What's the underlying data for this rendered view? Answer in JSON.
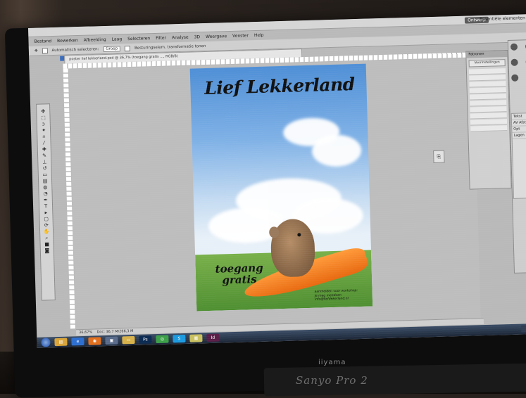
{
  "photo": {
    "monitor_brand": "iiyama",
    "keyboard_text": "Sanyo Pro 2"
  },
  "photoshop": {
    "menu": [
      "Bestand",
      "Bewerken",
      "Afbeelding",
      "Laag",
      "Selecteren",
      "Filter",
      "Analyse",
      "3D",
      "Weergave",
      "Venster",
      "Help"
    ],
    "workspace_button": "Ontwerp",
    "workspace_label": "Essentiële elementen",
    "options": {
      "auto_select_label": "Automatisch selecteren:",
      "auto_select_value": "Groep",
      "transform_label": "Besturingselem. transformatie tonen"
    },
    "document_tab": "poster lief lekkerland.psd @ 36,7% (toegang gratis ..., RGB/8)",
    "status_zoom": "36,67%",
    "status_doc": "Doc: 36,7 M/266,3 M",
    "panel": {
      "title": "Patronen",
      "preset_button": "Voorinstellingen"
    },
    "layers_panel": [
      "Tekst",
      "AV Afstand",
      "Opt",
      "Lagen"
    ],
    "colors": {
      "workspace": "#bdbdbd",
      "panel": "#d0d0d0",
      "sky": "#4f8fd6",
      "grass": "#4f8f32",
      "carrot": "#e86910"
    }
  },
  "poster": {
    "title": "Lief Lekkerland",
    "free_entry_line1": "toegang",
    "free_entry_line2": "gratis",
    "info_lines": [
      "aanmelden voor workshop:",
      "je mag meedoen",
      "info@liefdekerland.nl"
    ]
  },
  "taskbar": {
    "apps": [
      "Explorer",
      "Internet Explorer",
      "Firefox",
      "Photoshop",
      "Spotify",
      "Skype",
      "InDesign"
    ]
  }
}
